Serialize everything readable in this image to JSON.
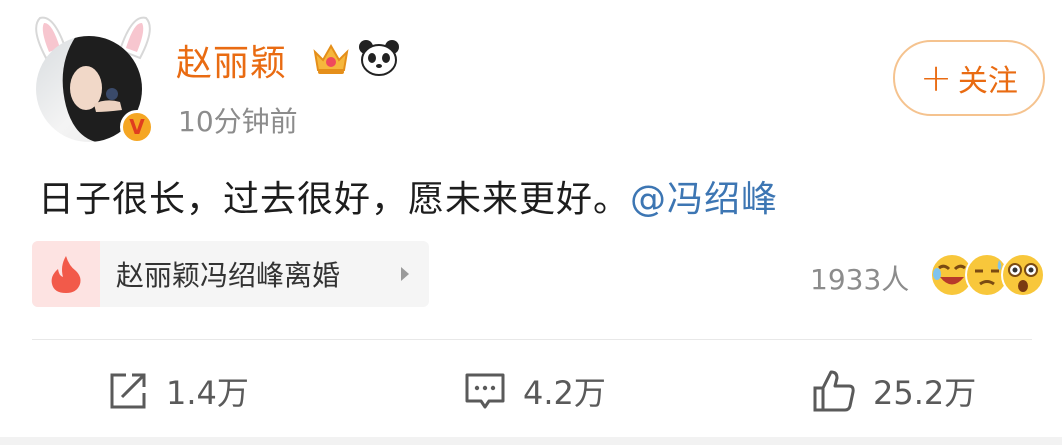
{
  "post": {
    "author": "赵丽颖",
    "time": "10分钟前",
    "follow_label": "关注",
    "text_main": "日子很长，过去很好，愿未来更好。",
    "mention": "@冯绍峰"
  },
  "topic": {
    "label": "赵丽颖冯绍峰离婚",
    "reaction_count": "1933人"
  },
  "actions": {
    "repost": "1.4万",
    "comment": "4.2万",
    "like": "25.2万"
  },
  "colors": {
    "accent": "#e96b12",
    "mention": "#3d76b3",
    "badge": "#f5a623"
  },
  "icons": [
    "crown-icon",
    "panda-icon",
    "fire-icon",
    "share-icon",
    "comment-icon",
    "like-icon"
  ]
}
